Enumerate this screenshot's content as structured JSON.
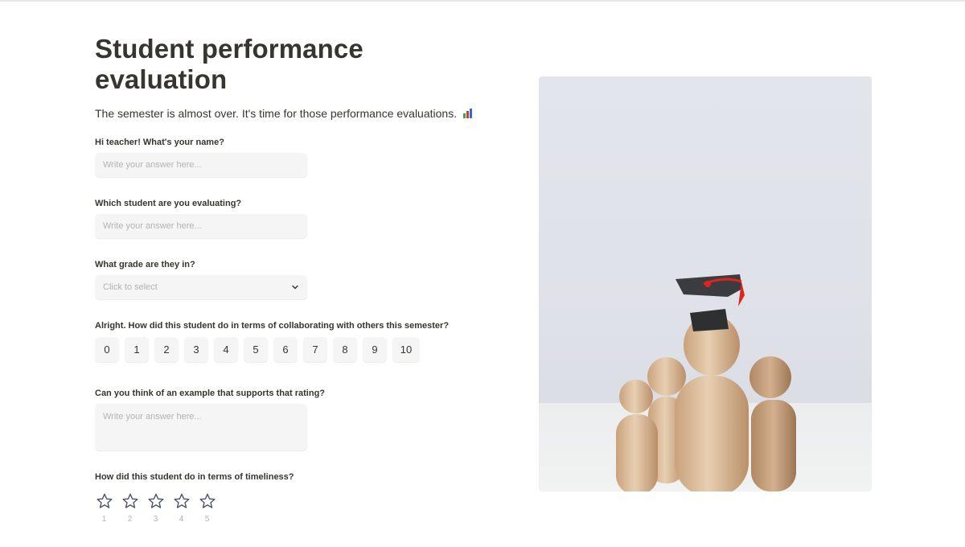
{
  "form": {
    "title": "Student performance evaluation",
    "subtitle": "The semester is almost over. It's time for those performance evaluations.",
    "subtitle_icon": "bar-chart-emoji",
    "questions": {
      "name": {
        "label": "Hi teacher! What's your name?",
        "placeholder": "Write your answer here...",
        "value": ""
      },
      "student": {
        "label": "Which student are you evaluating?",
        "placeholder": "Write your answer here...",
        "value": ""
      },
      "grade": {
        "label": "What grade are they in?",
        "placeholder": "Click to select",
        "selected": ""
      },
      "collaboration": {
        "label": "Alright. How did this student do in terms of collaborating with others this semester?",
        "options": [
          "0",
          "1",
          "2",
          "3",
          "4",
          "5",
          "6",
          "7",
          "8",
          "9",
          "10"
        ],
        "selected": null
      },
      "example": {
        "label": "Can you think of an example that supports that rating?",
        "placeholder": "Write your answer here...",
        "value": ""
      },
      "timeliness": {
        "label": "How did this student do in terms of timeliness?",
        "stars": [
          "1",
          "2",
          "3",
          "4",
          "5"
        ],
        "rating": 0
      }
    }
  },
  "image": {
    "description": "Wooden peg figures, the tallest wearing a black graduation cap with red tassel"
  },
  "colors": {
    "text": "#37352f",
    "field_bg": "#f5f5f5",
    "placeholder": "#b3b3b3",
    "star_outline": "#4a5068"
  }
}
